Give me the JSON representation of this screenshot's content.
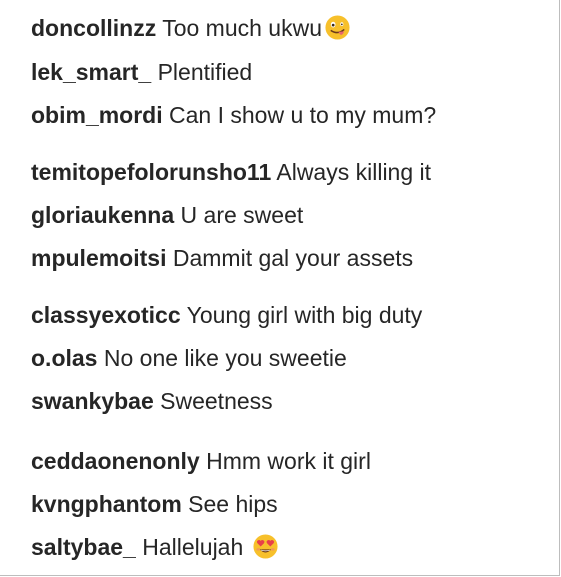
{
  "comments": [
    {
      "username": "doncollinzz",
      "text": "Too much ukwu",
      "emoji": "zany-face-emoji"
    },
    {
      "username": "lek_smart_",
      "text": "Plentified"
    },
    {
      "username": "obim_mordi",
      "text": "Can I show u to my mum?"
    },
    {
      "username": "temitopefolorunsho11",
      "text": "Always killing it"
    },
    {
      "username": "gloriaukenna",
      "text": "U are sweet"
    },
    {
      "username": "mpulemoitsi",
      "text": "Dammit gal your assets"
    },
    {
      "username": "classyexoticc",
      "text": "Young girl with big duty"
    },
    {
      "username": "o.olas",
      "text": "No one like you sweetie"
    },
    {
      "username": "swankybae",
      "text": "Sweetness"
    },
    {
      "username": "ceddaonenonly",
      "text": "Hmm work it girl"
    },
    {
      "username": "kvngphantom",
      "text": "See hips"
    },
    {
      "username": "saltybae_",
      "text": "Hallelujah",
      "emoji": "heart-eyes-emoji"
    }
  ],
  "colors": {
    "text": "#262626",
    "emoji_yellow": "#f7c02b",
    "emoji_heart": "#e8404a",
    "background": "#ffffff"
  }
}
